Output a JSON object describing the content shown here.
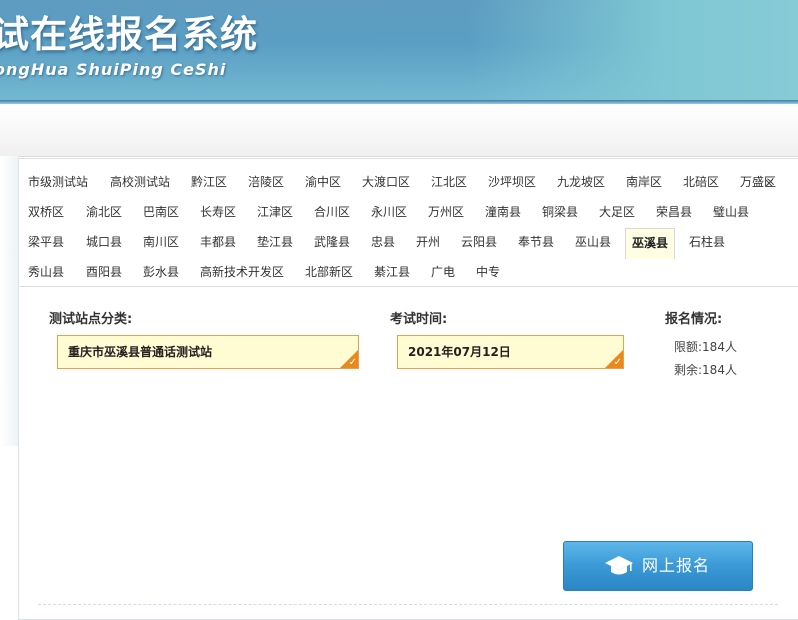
{
  "header": {
    "title": "试在线报名系统",
    "subtitle": "ongHua ShuiPing CeShi"
  },
  "districts": {
    "row1": [
      "市级测试站",
      "高校测试站",
      "黔江区",
      "涪陵区",
      "渝中区",
      "大渡口区",
      "江北区",
      "沙坪坝区",
      "九龙坡区",
      "南岸区",
      "北碚区",
      "万盛区"
    ],
    "row2": [
      "双桥区",
      "渝北区",
      "巴南区",
      "长寿区",
      "江津区",
      "合川区",
      "永川区",
      "万州区",
      "潼南县",
      "铜梁县",
      "大足区",
      "荣昌县",
      "璧山县"
    ],
    "row3": [
      "梁平县",
      "城口县",
      "南川区",
      "丰都县",
      "垫江县",
      "武隆县",
      "忠县",
      "开州",
      "云阳县",
      "奉节县",
      "巫山县",
      "巫溪县",
      "石柱县"
    ],
    "row4": [
      "秀山县",
      "酉阳县",
      "彭水县",
      "高新技术开发区",
      "北部新区",
      "綦江县",
      "广电",
      "中专"
    ],
    "selected": "巫溪县",
    "close_symbol": "×"
  },
  "form": {
    "category_label": "测试站点分类:",
    "category_value": "重庆市巫溪县普通话测试站",
    "time_label": "考试时间:",
    "time_value": "2021年07月12日",
    "status_label": "报名情况:",
    "quota_label": "限额:",
    "quota_value": "184人",
    "remaining_label": "剩余:",
    "remaining_value": "184人"
  },
  "signup_button": {
    "label": "网上报名",
    "icon": "graduation-cap-icon"
  },
  "colors": {
    "banner": "#5b9fc4",
    "field_bg": "#fffbd3",
    "field_border": "#e8a04c",
    "button": "#3a99d6",
    "selected_tab": "#fffde2"
  }
}
